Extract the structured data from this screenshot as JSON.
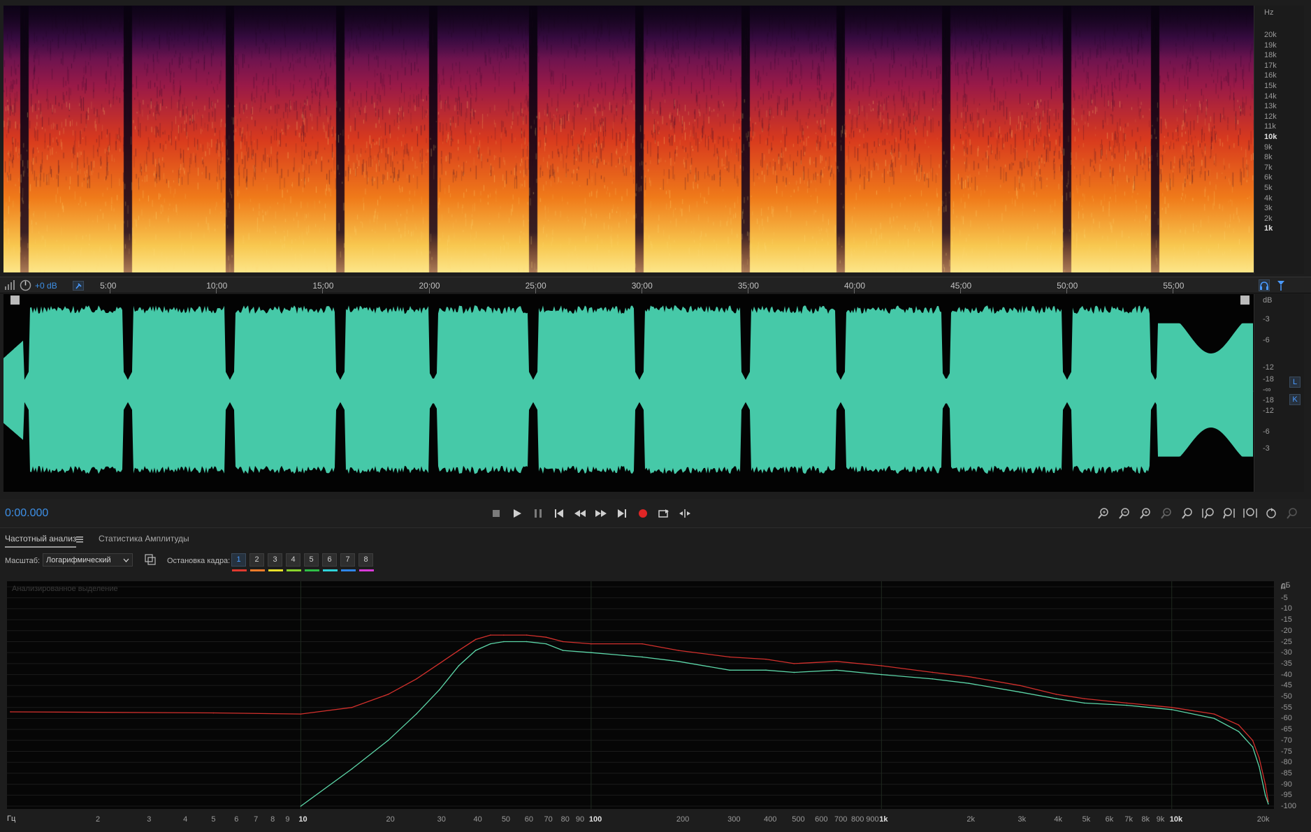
{
  "spectrogram": {
    "unit": "Hz",
    "freq_labels": [
      "20k",
      "19k",
      "18k",
      "17k",
      "16k",
      "15k",
      "14k",
      "13k",
      "12k",
      "11k",
      "10k",
      "9k",
      "8k",
      "7k",
      "6k",
      "5k",
      "4k",
      "3k",
      "2k",
      "1k"
    ]
  },
  "toolbar": {
    "gain": "+0 dB"
  },
  "timeline": {
    "labels": [
      "5:00",
      "10:00",
      "15:00",
      "20:00",
      "25:00",
      "30:00",
      "35:00",
      "40:00",
      "45:00",
      "50:00",
      "55:00"
    ]
  },
  "waveform": {
    "unit": "dB",
    "db_labels": [
      "-3",
      "-6",
      "-12",
      "-18",
      "-∞",
      "-18",
      "-12",
      "-6",
      "-3"
    ],
    "channel_left": "L",
    "channel_right": "K"
  },
  "transport": {
    "time": "0:00.000"
  },
  "panel": {
    "tab_freq": "Частотный анализ",
    "tab_amp": "Статистика Амплитуды",
    "scale_label": "Масштаб:",
    "scale_value": "Логарифмический",
    "freeze_label": "Остановка кадра:",
    "frames": [
      "1",
      "2",
      "3",
      "4",
      "5",
      "6",
      "7",
      "8"
    ],
    "frame_colors": [
      "#e03a2f",
      "#f07b2a",
      "#e8e02a",
      "#8ad42d",
      "#2fbf47",
      "#2fd3d9",
      "#2f86e8",
      "#d83ad8"
    ]
  },
  "freq_chart": {
    "selection_label": "Анализированное выделение",
    "db_unit": "дБ",
    "db_labels": [
      "0",
      "-5",
      "-10",
      "-15",
      "-20",
      "-25",
      "-30",
      "-35",
      "-40",
      "-45",
      "-50",
      "-55",
      "-60",
      "-65",
      "-70",
      "-75",
      "-80",
      "-85",
      "-90",
      "-95",
      "-100"
    ],
    "x_unit": "Гц",
    "x_labels": [
      "2",
      "3",
      "4",
      "5",
      "6",
      "7",
      "8",
      "9",
      "10",
      "20",
      "30",
      "40",
      "50",
      "60",
      "70",
      "80",
      "90",
      "100",
      "200",
      "300",
      "400",
      "500",
      "600",
      "700",
      "800",
      "900",
      "1k",
      "2k",
      "3k",
      "4k",
      "5k",
      "6k",
      "7k",
      "8k",
      "9k",
      "10k",
      "20k"
    ]
  },
  "chart_data": {
    "type": "line",
    "xlabel": "Гц",
    "ylabel": "дБ",
    "xscale": "log",
    "xlim": [
      1,
      22000
    ],
    "ylim": [
      -100,
      0
    ],
    "x": [
      1,
      5,
      10,
      15,
      20,
      25,
      30,
      35,
      40,
      45,
      50,
      60,
      70,
      80,
      100,
      150,
      200,
      300,
      400,
      500,
      700,
      1000,
      1500,
      2000,
      3000,
      4000,
      5000,
      7000,
      10000,
      14000,
      17000,
      19000,
      20000,
      21000,
      21500
    ],
    "series": [
      {
        "name": "",
        "color": "#d2302c",
        "values": [
          -57,
          -57.5,
          -58,
          -55,
          -49,
          -42,
          -35,
          -29,
          -24,
          -22,
          -22,
          -22,
          -23,
          -25,
          -26,
          -26,
          -29,
          -32,
          -33,
          -35,
          -34,
          -36,
          -39,
          -41,
          -45,
          -49,
          -51,
          -53,
          -55,
          -58,
          -63,
          -70,
          -78,
          -90,
          -98
        ]
      },
      {
        "name": "",
        "color": "#5cd6a8",
        "values": [
          null,
          null,
          -100,
          -83,
          -70,
          -58,
          -47,
          -36,
          -29,
          -26,
          -25,
          -25,
          -26,
          -29,
          -30,
          -32,
          -34,
          -38,
          -38,
          -39,
          -38,
          -40,
          -42,
          -44,
          -48,
          -51,
          -53,
          -54,
          -56,
          -60,
          -66,
          -73,
          -82,
          -95,
          -99
        ]
      }
    ]
  }
}
